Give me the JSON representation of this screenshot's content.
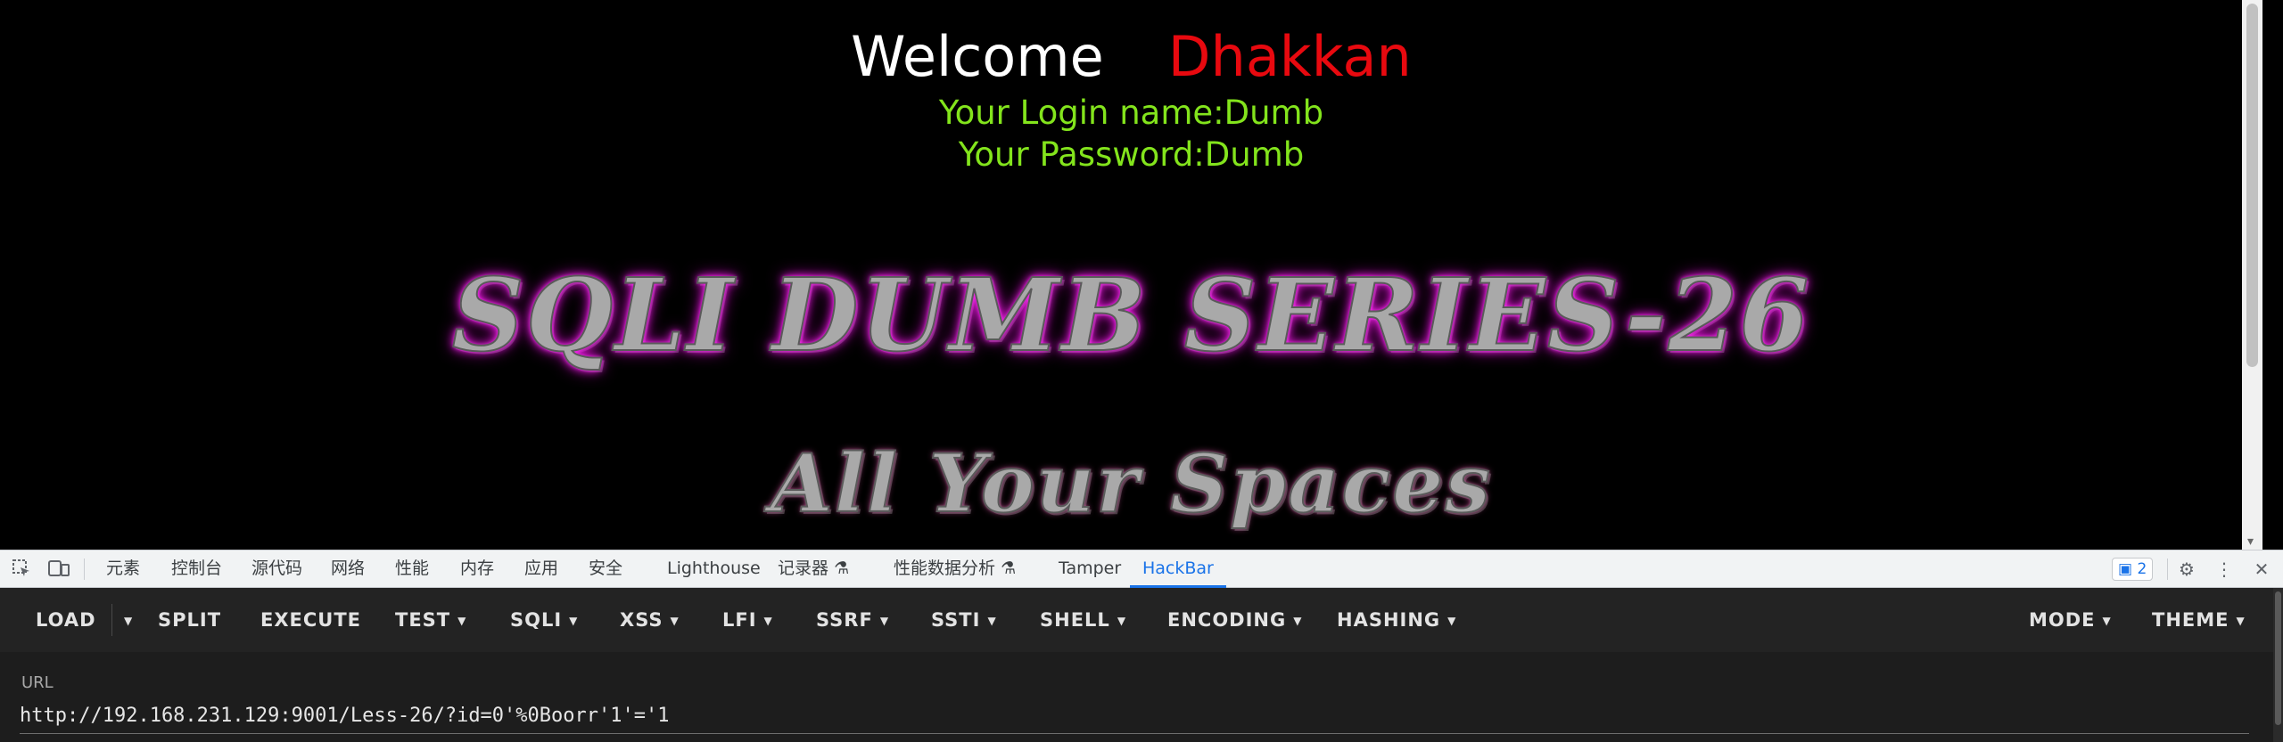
{
  "page": {
    "welcome": "Welcome",
    "user": "Dhakkan",
    "login_line": "Your Login name:Dumb",
    "password_line": "Your Password:Dumb",
    "title_banner": "SQLI DUMB SERIES-26",
    "subtitle_banner": "All Your Spaces"
  },
  "devtools": {
    "tabs": [
      "元素",
      "控制台",
      "源代码",
      "网络",
      "性能",
      "内存",
      "应用",
      "安全",
      "Lighthouse",
      "记录器",
      "性能数据分析",
      "Tamper",
      "HackBar"
    ],
    "active_tab": "HackBar",
    "issues_count": "2"
  },
  "hackbar": {
    "buttons": [
      "LOAD",
      "SPLIT",
      "EXECUTE",
      "TEST",
      "SQLI",
      "XSS",
      "LFI",
      "SSRF",
      "SSTI",
      "SHELL",
      "ENCODING",
      "HASHING",
      "MODE",
      "THEME"
    ],
    "url_label": "URL",
    "url_value": "http://192.168.231.129:9001/Less-26/?id=0'%0Boorr'1'='1"
  },
  "colors": {
    "welcome": "#ffffff",
    "user": "#e8090f",
    "login_text": "#83e41c",
    "banner_glow": "#ff2cf5",
    "active_tab": "#1a73e8",
    "hackbar_bg": "#1d1d1d"
  }
}
